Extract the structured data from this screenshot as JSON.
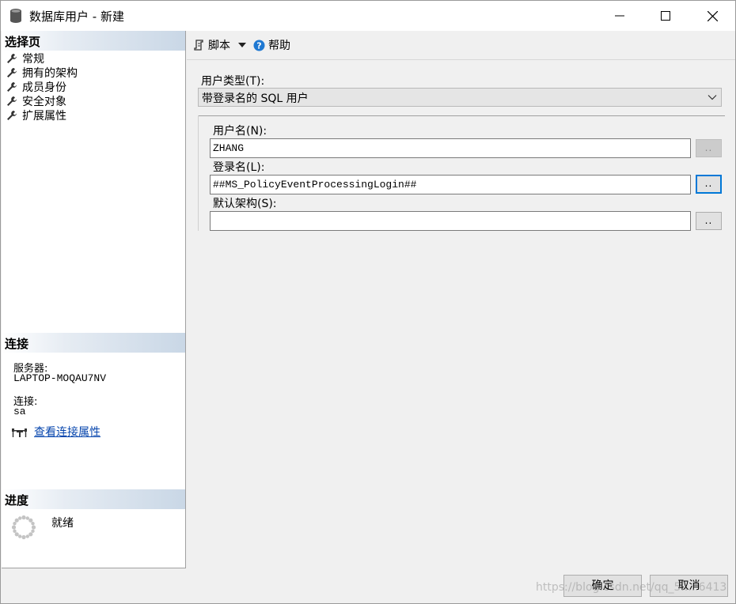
{
  "window": {
    "title": "数据库用户 - 新建",
    "icon": "database-icon",
    "controls": [
      "minimize-icon",
      "maximize-icon",
      "close-icon"
    ]
  },
  "left": {
    "select_page_header": "选择页",
    "pages": [
      {
        "label": "常规",
        "icon": "wrench-icon"
      },
      {
        "label": "拥有的架构",
        "icon": "wrench-icon"
      },
      {
        "label": "成员身份",
        "icon": "wrench-icon"
      },
      {
        "label": "安全对象",
        "icon": "wrench-icon"
      },
      {
        "label": "扩展属性",
        "icon": "wrench-icon"
      }
    ],
    "connection_header": "连接",
    "server_label": "服务器:",
    "server_value": "LAPTOP-MOQAU7NV",
    "connection_label": "连接:",
    "connection_value": "sa",
    "view_connection_props": "查看连接属性",
    "progress_header": "进度",
    "progress_status": "就绪"
  },
  "toolbar": {
    "script_label": "脚本",
    "help_label": "帮助"
  },
  "form": {
    "user_type_label": "用户类型(T):",
    "user_type_value": "带登录名的 SQL 用户",
    "username_label": "用户名(N):",
    "username_value": "ZHANG",
    "login_label": "登录名(L):",
    "login_value": "##MS_PolicyEventProcessingLogin##",
    "default_schema_label": "默认架构(S):",
    "default_schema_value": "",
    "browse_label": ".."
  },
  "footer": {
    "ok_label": "确定",
    "cancel_label": "取消",
    "watermark": "https://blog.csdn.net/qq_5.....6413"
  },
  "colors": {
    "header_gradient_end": "#c9d7e6",
    "link": "#0645ad",
    "focus": "#0078d7"
  }
}
